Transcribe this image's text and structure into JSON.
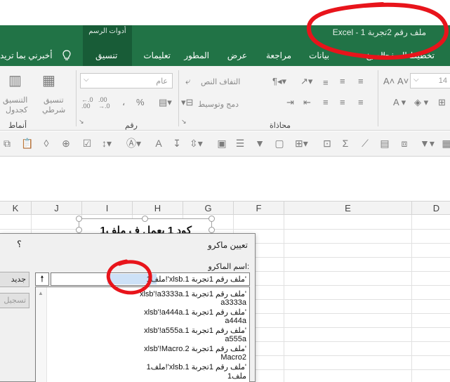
{
  "app": {
    "window_title": "ملف رقم 2تجربة 1  -  Excel",
    "tools_group_label": "أدوات الرسم"
  },
  "tabs": [
    {
      "label": "تخطيط الصفحة"
    },
    {
      "label": "الصيغ"
    },
    {
      "label": "بيانات"
    },
    {
      "label": "مراجعة"
    },
    {
      "label": "عرض"
    },
    {
      "label": "المطور"
    },
    {
      "label": "تعليمات"
    },
    {
      "label": "تنسيق",
      "active": true
    },
    {
      "label": "أخبرني بما تريد"
    }
  ],
  "ribbon": {
    "font_size": "14",
    "number_format": "عام",
    "wrap_text": "التفاف النص",
    "merge_center": "دمج وتوسيط",
    "conditional_format_1": "تنسيق",
    "conditional_format_2": "شرطي",
    "format_table_1": "التنسيق",
    "format_table_2": "كجدول",
    "currency_sign": "%",
    "comma_sign": "،",
    "dec_inc": ".00\n←.0",
    "dec_dec": ".0\n.00",
    "groups": {
      "alignment": "محاذاة",
      "number": "رقم",
      "styles": "أنماط"
    }
  },
  "columns": [
    "D",
    "E",
    "F",
    "G",
    "H",
    "I",
    "J",
    "K"
  ],
  "sheet_shape": {
    "text": "كود 1 يعمل ف ملف1"
  },
  "dialog": {
    "title": "تعيين ماكرو",
    "help": "؟",
    "macro_name_label": "اسم الماكرو:",
    "macro_name_value": "'ملف رقم 1تجربة 1.xlsb'!ملف1",
    "updir_icon": "up-arrow-icon",
    "buttons": {
      "new": "جديد",
      "record": "تسجيل"
    },
    "macros": [
      "'ملف رقم 1تجربة 1.xlsb'!a3333a",
      "a3333a",
      "'ملف رقم 1تجربة 1.xlsb'!a444a",
      "a444a",
      "'ملف رقم 1تجربة 1.xlsb'!a555a",
      "a555a",
      "'ملف رقم 1تجربة 2.xlsb'!Macro",
      "Macro2",
      "'ملف رقم 1تجربة 1.xlsb'!ملف1",
      "ملف1"
    ]
  },
  "colors": {
    "excel_green": "#217346",
    "excel_green_dark": "#185c37",
    "annotation_red": "#e8141b"
  }
}
